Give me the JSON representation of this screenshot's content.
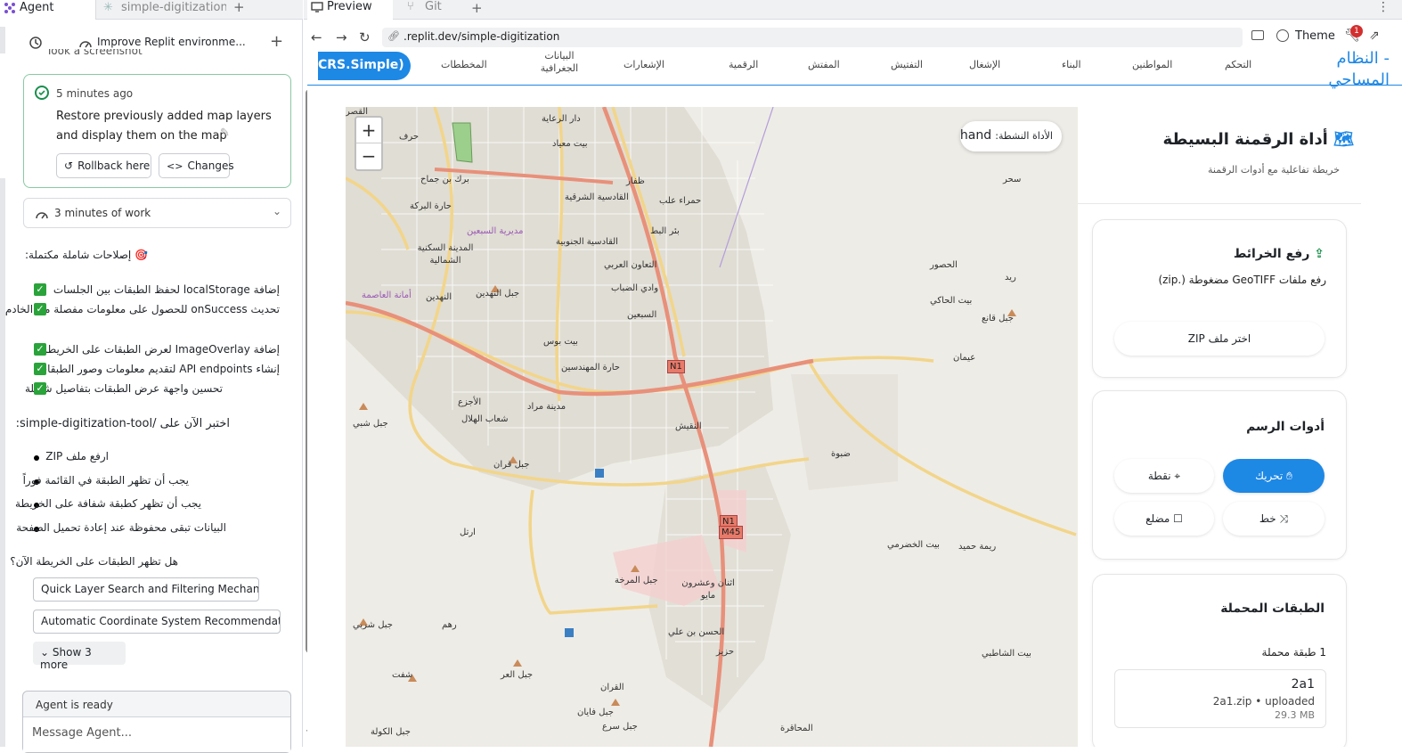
{
  "left_panel": {
    "agent_tab": "Agent",
    "file_tab": "simple-digitization-t",
    "improve_label": "Improve Replit environme...",
    "took_screenshot": "Took a screenshot",
    "checkpoint": {
      "time": "5 minutes ago",
      "text": "Restore previously added map layers and display them on the map",
      "rollback_label": "Rollback here",
      "changes_label": "Changes"
    },
    "work_summary": "3 minutes of work",
    "message": {
      "heading": "🎯 إصلاحات شاملة مكتملة:",
      "checks": [
        "إضافة localStorage لحفظ الطبقات بين الجلسات",
        "تحديث onSuccess للحصول على معلومات مفصلة من الخادم",
        "إضافة ImageOverlay لعرض الطبقات على الخريطة",
        "إنشاء API endpoints لتقديم معلومات وصور الطبقات",
        "تحسين واجهة عرض الطبقات بتفاصيل شاملة"
      ],
      "test_line": "اختبر الآن على /simple-digitization-tool:",
      "bullets": [
        "ارفع ملف ZIP",
        "يجب أن تظهر الطبقة في القائمة فوراً",
        "يجب أن تظهر كطبقة شفافة على الخريطة",
        "البيانات تبقى محفوظة عند إعادة تحميل الصفحة"
      ],
      "question": "هل تظهر الطبقات على الخريطة الآن؟"
    },
    "suggestions": [
      "Quick Layer Search and Filtering Mechanism",
      "Automatic Coordinate System Recommendati..."
    ],
    "show_more": "Show 3 more",
    "agent_status": "Agent is ready",
    "message_placeholder": "Message Agent..."
  },
  "right_panel": {
    "preview_tab": "Preview",
    "git_tab": "Git",
    "url": ".replit.dev/simple-digitization",
    "theme_label": "Theme",
    "notification_count": "1"
  },
  "site": {
    "crs_label": "CRS.Simple)",
    "brand": "النظام المساحي",
    "brand_prefix": "-",
    "nav": [
      "المخططات",
      "البيانات الجغرافية",
      "الإشعارات",
      "الرقمية",
      "المفتش",
      "التفتيش",
      "الإشغال",
      "البناء",
      "المواطنين",
      "التحكم"
    ],
    "map": {
      "zoom_in": "+",
      "zoom_out": "−",
      "active_tool_label": "الأداة النشطة:",
      "active_tool_value": "hand",
      "places": [
        "دار الرعاية",
        "بيت معياد",
        "ظفار",
        "برك بن جماح",
        "القادسية الشرقية",
        "حمراء علب",
        "حارة البركة",
        "القادسية الجنوبية",
        "بئر البط",
        "المدينة السكنية الشمالية",
        "التعاون العربي",
        "وادي الضباب",
        "النهدين",
        "السبعين",
        "بيت بوس",
        "حارة المهندسين",
        "الأجزع",
        "مدينة مراد",
        "شعاب الهلال",
        "النقيش",
        "ضبوة",
        "ارتل",
        "جبل المرخة",
        "اثنان وعشرون مايو",
        "الحسن بن علي",
        "جبل العر",
        "شفت",
        "جبل فايان",
        "القران",
        "جبل سرع",
        "المحاقرة",
        "جبل الكولة",
        "بيت الخضرمي",
        "ريمة حميد",
        "بيت الشاطبي",
        "عيمان",
        "جبل قانع",
        "بيت الحاكي",
        "الحصور",
        "ريد",
        "سحر",
        "جبل النهدين",
        "جبل قران",
        "رهم",
        "جبل شبي",
        "جبل شربي",
        "حزيز",
        "أمانة العاصمة",
        "مديرية السبعين",
        "القصر",
        "حرف"
      ],
      "roads": [
        "N1",
        "N1",
        "M45"
      ]
    },
    "panel": {
      "title": "أداة الرقمنة البسيطة",
      "subtitle": "خريطة تفاعلية مع أدوات الرقمنة",
      "upload": {
        "title": "رفع الخرائط",
        "desc": "رفع ملفات GeoTIFF مضغوطة (.zip)",
        "button": "اختر ملف ZIP"
      },
      "tools": {
        "title": "أدوات الرسم",
        "move": "تحريك",
        "point": "نقطة",
        "line": "خط",
        "polygon": "مضلع"
      },
      "layers": {
        "title": "الطبقات المحملة",
        "count": "1 طبقة محملة",
        "item_name": "2a1",
        "item_meta": "2a1.zip • uploaded",
        "item_size": "29.3 MB"
      }
    }
  },
  "colors": {
    "accent": "#1e88e5",
    "success": "#1a8f4d",
    "map_bg": "#eeece6",
    "primary_road": "#e8907a",
    "secondary_road": "#f4d089"
  }
}
